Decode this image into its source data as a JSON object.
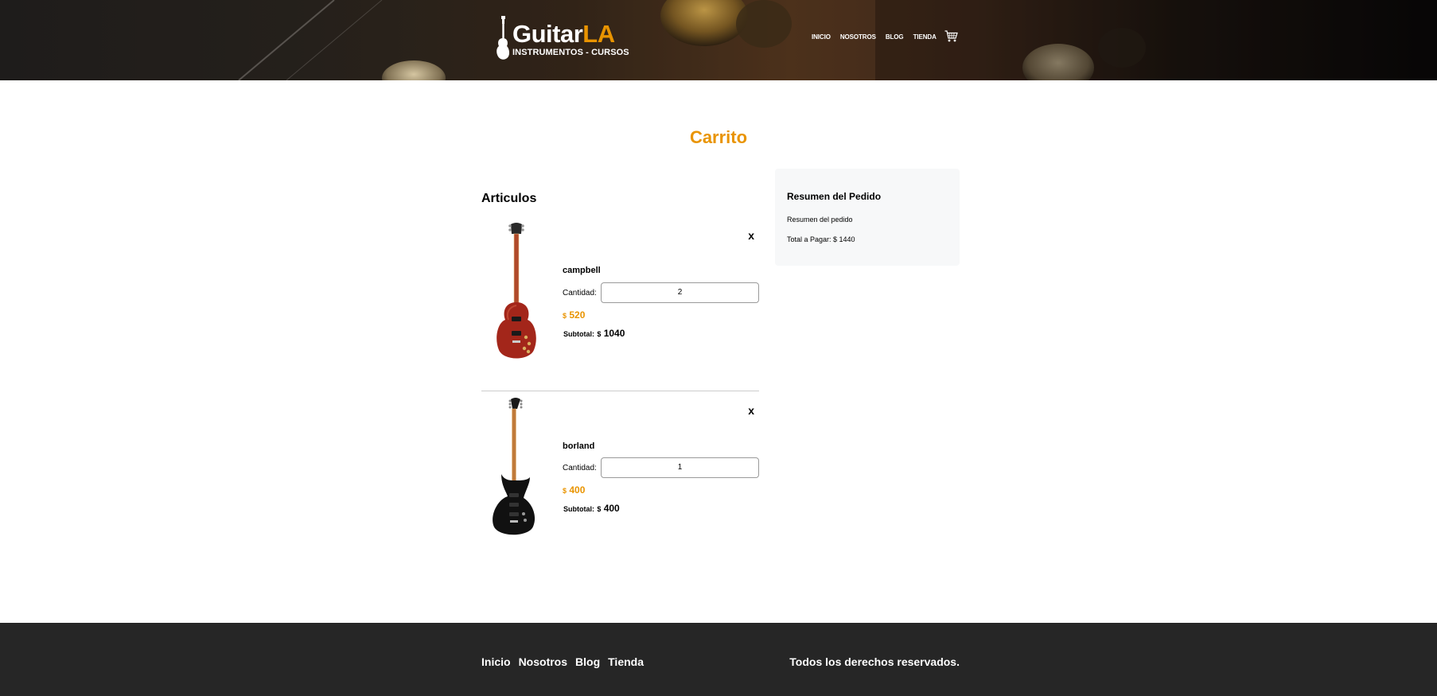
{
  "header": {
    "logo": {
      "word_main": "Guitar",
      "word_accent": "LA",
      "tagline": "INSTRUMENTOS - CURSOS"
    },
    "nav": [
      "INICIO",
      "NOSOTROS",
      "BLOG",
      "TIENDA"
    ],
    "cart_icon": "shopping-cart-icon",
    "colors": {
      "accent": "#e99401",
      "text": "#ffffff"
    }
  },
  "main": {
    "title": "Carrito",
    "articles_heading": "Articulos",
    "items": [
      {
        "remove": "x",
        "name": "campbell",
        "qty_label": "Cantidad:",
        "qty_value": "2",
        "price_currency": "$",
        "price": "520",
        "subtotal_label": "Subtotal:",
        "subtotal_currency": "$",
        "subtotal": "1040",
        "image": "red-electric-guitar"
      },
      {
        "remove": "x",
        "name": "borland",
        "qty_label": "Cantidad:",
        "qty_value": "1",
        "price_currency": "$",
        "price": "400",
        "subtotal_label": "Subtotal:",
        "subtotal_currency": "$",
        "subtotal": "400",
        "image": "black-electric-guitar"
      }
    ],
    "summary": {
      "title": "Resumen del Pedido",
      "text": "Resumen del pedido",
      "total": "Total a Pagar: $ 1440"
    }
  },
  "footer": {
    "nav": [
      "Inicio",
      "Nosotros",
      "Blog",
      "Tienda"
    ],
    "copyright": "Todos los derechos reservados."
  }
}
